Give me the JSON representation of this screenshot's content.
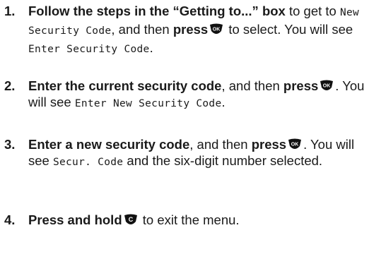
{
  "steps": [
    {
      "number": "1.",
      "bold_a": "Follow the steps in the “Getting to...” box",
      "text_a": " to get to ",
      "lcd_a": "New Security Code",
      "text_b": ", and then ",
      "bold_b": "press",
      "icon": "ok-key-icon",
      "text_c": " to select. You will see ",
      "lcd_b": "Enter Security Code",
      "text_d": "."
    },
    {
      "number": "2.",
      "bold_a": "Enter the current security code",
      "text_a": ", and then ",
      "bold_b": "press",
      "icon": "ok-key-icon",
      "text_b": ". You will see ",
      "lcd_a": "Enter New Security Code",
      "text_c": "."
    },
    {
      "number": "3.",
      "bold_a": "Enter a new security code",
      "text_a": ", and then ",
      "bold_b": "press",
      "icon": "ok-key-icon",
      "text_b": ". You will see ",
      "lcd_a": "Secur. Code",
      "text_c": " and the six-digit number selected."
    },
    {
      "number": "4.",
      "bold_a": "Press and hold",
      "icon": "clear-key-icon",
      "text_a": " to exit the menu."
    }
  ],
  "icons": {
    "ok_key_label": "OK",
    "clear_key_label": "C"
  },
  "colors": {
    "key_fill": "#111111",
    "key_text": "#ffffff"
  }
}
